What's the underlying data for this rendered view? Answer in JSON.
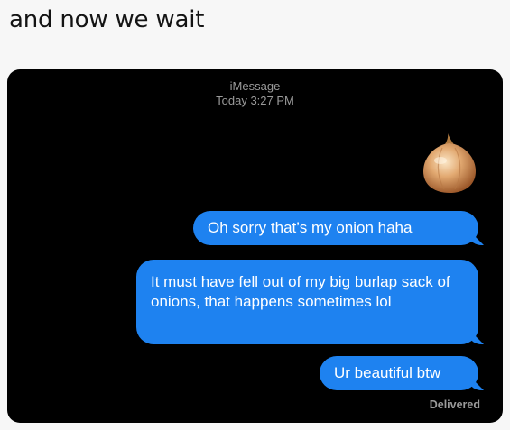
{
  "caption": "and now we wait",
  "conversation": {
    "service": "iMessage",
    "timestamp": "Today 3:27 PM",
    "attachment_icon": "onion-emoji",
    "messages": [
      {
        "text": "Oh sorry that’s my onion haha",
        "sender": "me"
      },
      {
        "text": "It must have fell out of my big burlap sack of onions, that happens sometimes lol",
        "sender": "me"
      },
      {
        "text": "Ur beautiful btw",
        "sender": "me"
      }
    ],
    "status": "Delivered"
  },
  "colors": {
    "background": "#000000",
    "bubble": "#1e82f0",
    "meta_text": "#9a9a9a",
    "caption_bg": "#f7f7f7"
  }
}
